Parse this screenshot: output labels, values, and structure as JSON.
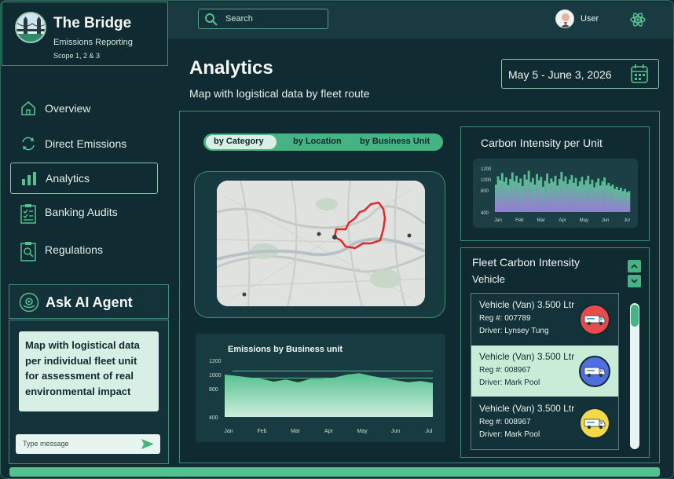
{
  "brand": {
    "title": "The Bridge",
    "subtitle": "Emissions Reporting",
    "scope": "Scope 1, 2 & 3"
  },
  "topbar": {
    "search_placeholder": "Search",
    "user_label": "User"
  },
  "nav": [
    {
      "label": "Overview",
      "icon": "home-icon"
    },
    {
      "label": "Direct Emissions",
      "icon": "refresh-icon"
    },
    {
      "label": "Analytics",
      "icon": "bar-chart-icon",
      "active": true
    },
    {
      "label": "Banking Audits",
      "icon": "checklist-icon"
    },
    {
      "label": "Regulations",
      "icon": "document-search-icon"
    }
  ],
  "ai": {
    "title": "Ask AI Agent",
    "message": "Map with logistical data per individual fleet unit for assessment of real environmental impact",
    "input_placeholder": "Type message"
  },
  "page": {
    "title": "Analytics",
    "subtitle": "Map with logistical data by fleet route",
    "date_range": "May 5 - June 3, 2026"
  },
  "segments": [
    "by Category",
    "by Location",
    "by Business Unit"
  ],
  "fleet": {
    "title": "Fleet Carbon Intensity",
    "subtitle": "Vehicle",
    "vehicles": [
      {
        "name": "Vehicle (Van) 3.500 Ltr",
        "reg": "Reg #: 007789",
        "driver": "Driver: Lynsey Tung",
        "color": "#e84b4b",
        "selected": false
      },
      {
        "name": "Vehicle (Van) 3.500 Ltr",
        "reg": "Reg #: 008967",
        "driver": "Driver: Mark Pool",
        "color": "#4f6ee0",
        "selected": true
      },
      {
        "name": "Vehicle (Van) 3.500 Ltr",
        "reg": "Reg #: 008967",
        "driver": "Driver: Mark Pool",
        "color": "#f2d84a",
        "selected": false
      }
    ]
  },
  "chart_data": [
    {
      "type": "area",
      "title": "Emissions by Business unit",
      "categories": [
        "Jan",
        "Feb",
        "Mar",
        "Apr",
        "May",
        "Jun",
        "Jul"
      ],
      "yticks": [
        1200,
        1000,
        800,
        400
      ],
      "ylim": [
        400,
        1200
      ],
      "values": [
        1000,
        980,
        960,
        940,
        900,
        930,
        890,
        940,
        940,
        960,
        1000,
        1020,
        980,
        950,
        920,
        890,
        910,
        880
      ],
      "reference_lines": [
        1050,
        950
      ],
      "grid": false,
      "color": "#55c08f"
    },
    {
      "type": "bar",
      "title": "Carbon Intensity per Unit",
      "categories": [
        "Jan",
        "Feb",
        "Mar",
        "Apr",
        "May",
        "Jun",
        "Jul"
      ],
      "yticks": [
        1200,
        1000,
        800,
        400
      ],
      "ylim": [
        400,
        1200
      ],
      "values": [
        900,
        1050,
        980,
        1110,
        950,
        1030,
        890,
        1000,
        1120,
        960,
        1060,
        930,
        1010,
        870,
        1080,
        990,
        1150,
        940,
        1020,
        900,
        1090,
        980,
        1040,
        860,
        970,
        1100,
        920,
        1010,
        950,
        1060,
        880,
        1000,
        1130,
        960,
        1050,
        910,
        990,
        1070,
        930,
        1020,
        870,
        960,
        1040,
        900,
        980,
        1060,
        910,
        990,
        850,
        940,
        1010,
        880,
        960,
        1030,
        890,
        930,
        870,
        900,
        820,
        860,
        800,
        840,
        780,
        820,
        760,
        780
      ],
      "grid": false,
      "colors": [
        "#55c08f",
        "#9b7ad8"
      ]
    }
  ]
}
